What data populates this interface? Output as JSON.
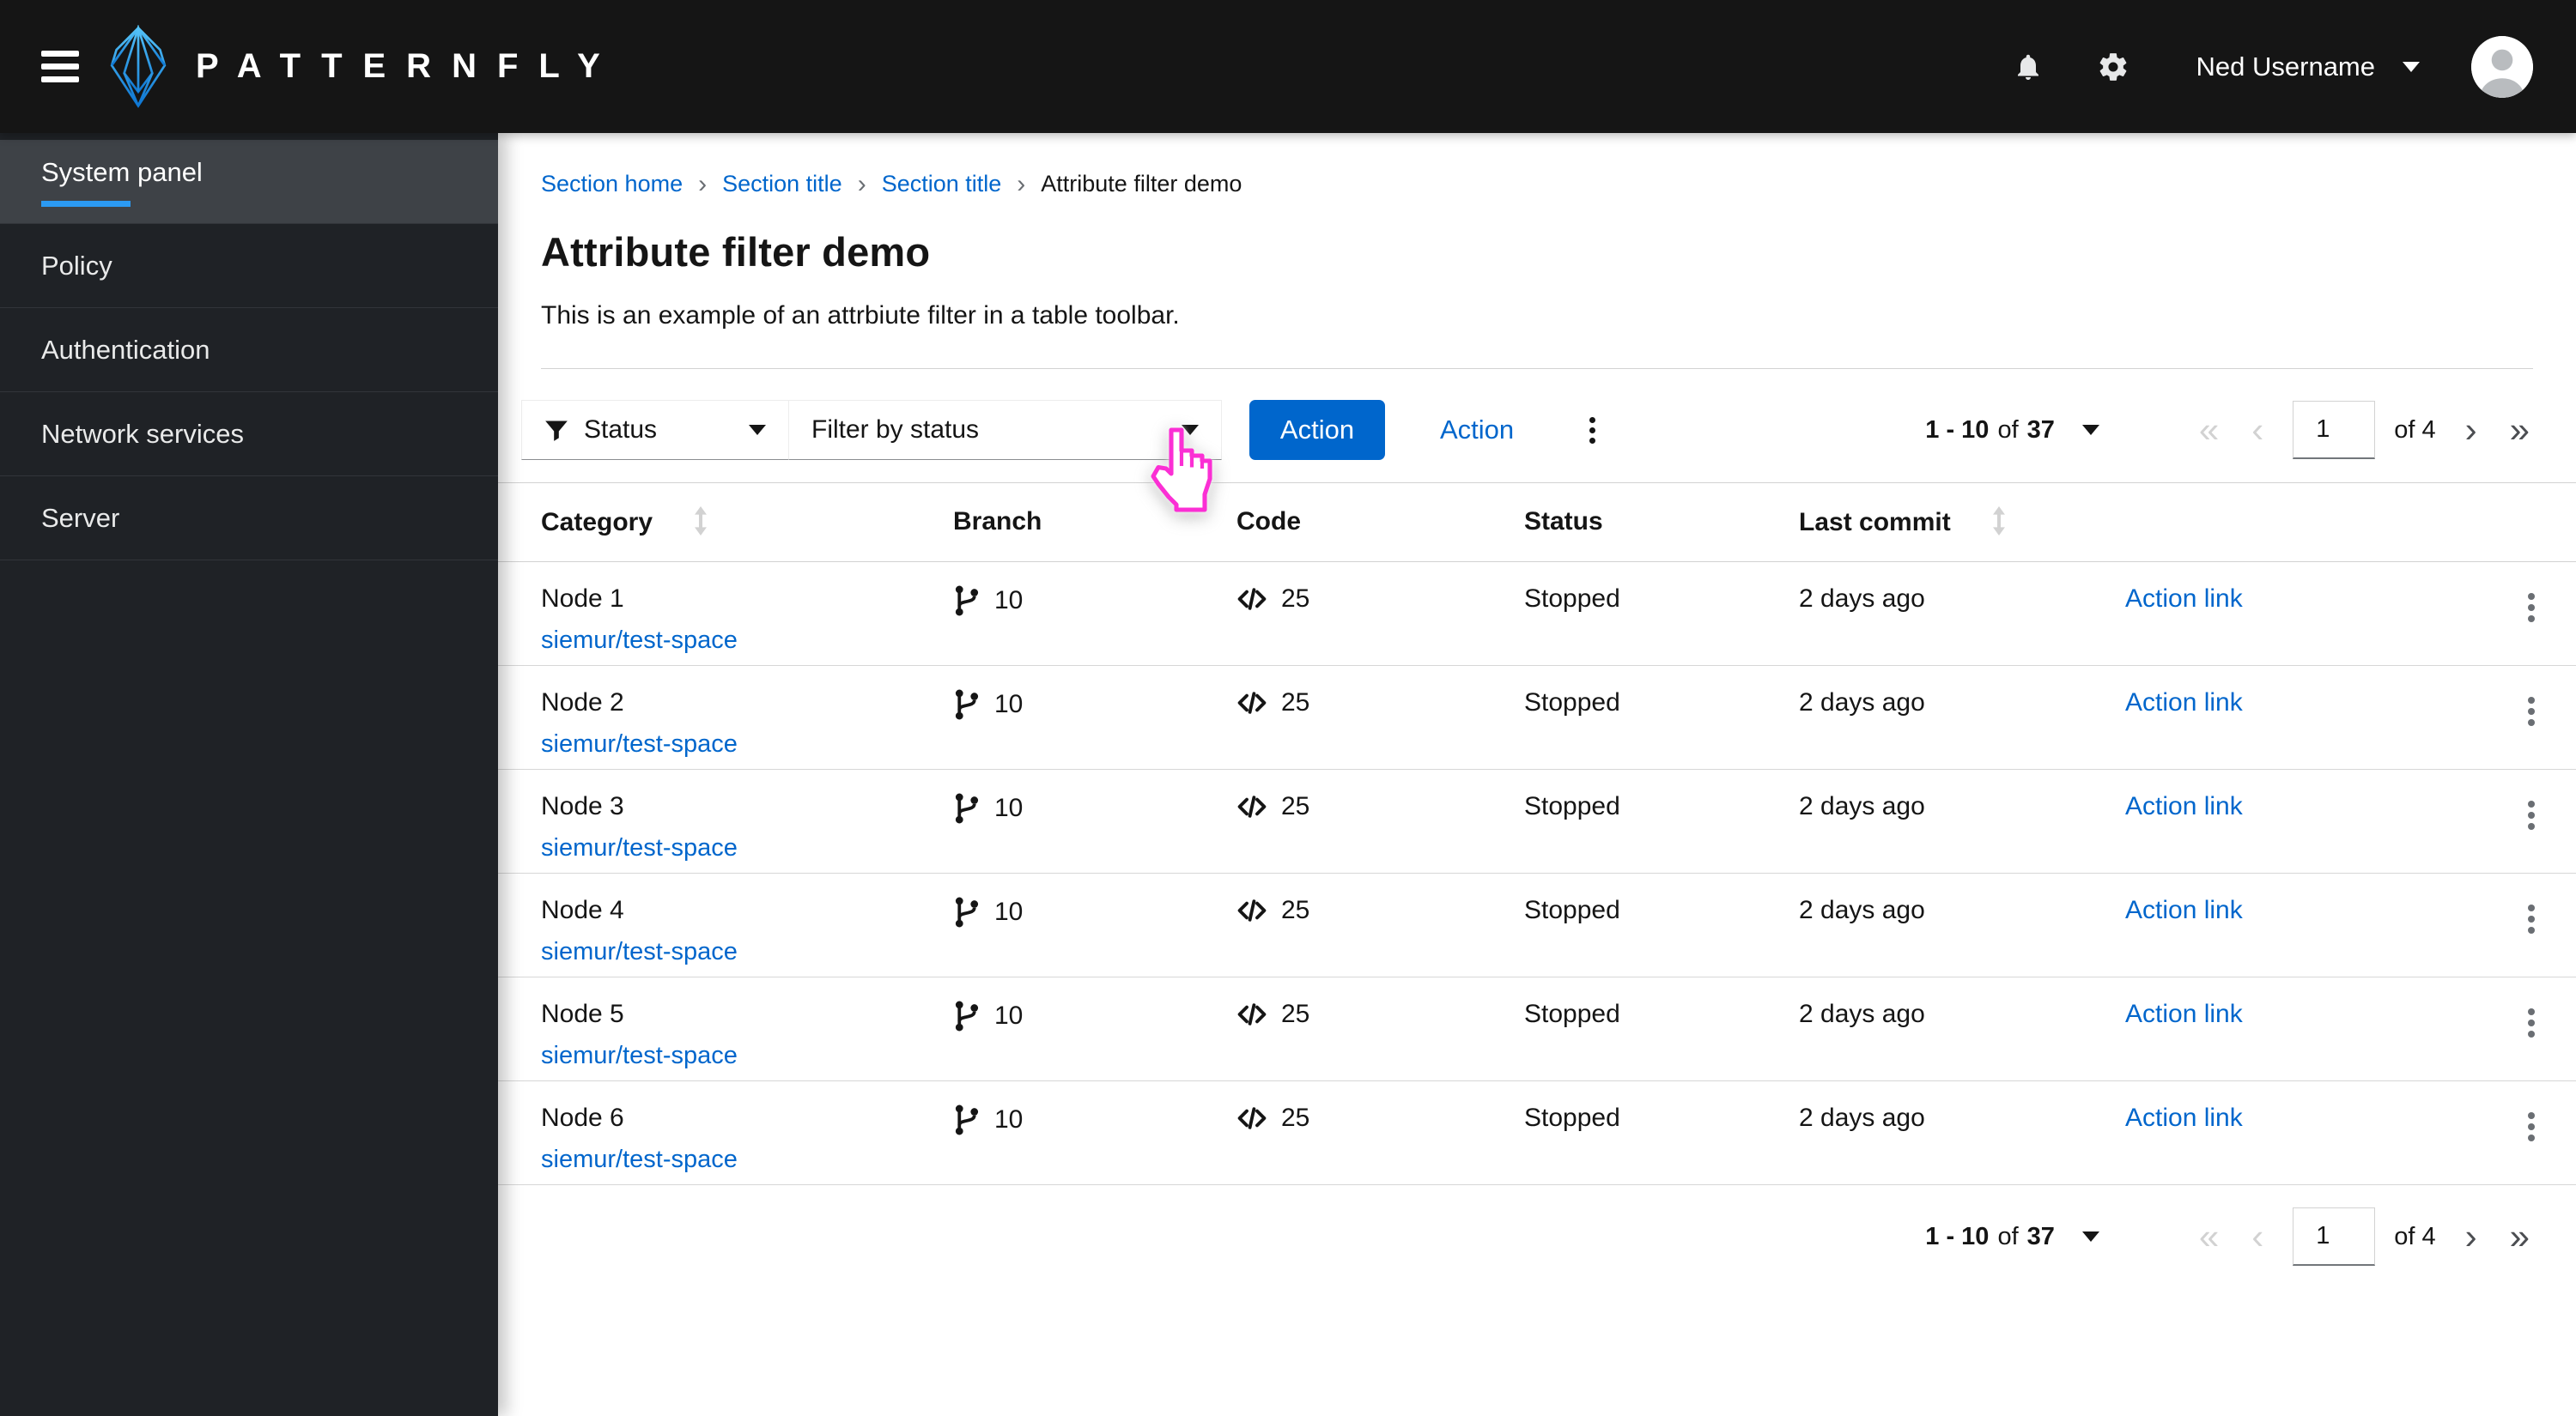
{
  "masthead": {
    "brand": "PATTERNFLY",
    "user": "Ned Username"
  },
  "sidebar": {
    "items": [
      {
        "label": "System panel"
      },
      {
        "label": "Policy"
      },
      {
        "label": "Authentication"
      },
      {
        "label": "Network services"
      },
      {
        "label": "Server"
      }
    ]
  },
  "breadcrumb": {
    "items": [
      "Section home",
      "Section title",
      "Section title",
      "Attribute filter demo"
    ],
    "separator": "›"
  },
  "page": {
    "title": "Attribute filter demo",
    "description": "This is an example of an attrbiute filter in a table toolbar."
  },
  "toolbar": {
    "attribute_label": "Status",
    "filter_placeholder": "Filter by status",
    "primary_action": "Action",
    "link_action": "Action"
  },
  "pagination": {
    "range": "1 - 10",
    "of_word": "of",
    "total": "37",
    "page": "1",
    "of_pages": "of 4",
    "first_icon": "«",
    "prev_icon": "‹",
    "next_icon": "›",
    "last_icon": "»"
  },
  "table": {
    "headers": [
      "Category",
      "Branch",
      "Code",
      "Status",
      "Last commit"
    ],
    "rows": [
      {
        "name": "Node 1",
        "link": "siemur/test-space",
        "branch": "10",
        "code": "25",
        "status": "Stopped",
        "commit": "2 days ago",
        "action": "Action link"
      },
      {
        "name": "Node 2",
        "link": "siemur/test-space",
        "branch": "10",
        "code": "25",
        "status": "Stopped",
        "commit": "2 days ago",
        "action": "Action link"
      },
      {
        "name": "Node 3",
        "link": "siemur/test-space",
        "branch": "10",
        "code": "25",
        "status": "Stopped",
        "commit": "2 days ago",
        "action": "Action link"
      },
      {
        "name": "Node 4",
        "link": "siemur/test-space",
        "branch": "10",
        "code": "25",
        "status": "Stopped",
        "commit": "2 days ago",
        "action": "Action link"
      },
      {
        "name": "Node 5",
        "link": "siemur/test-space",
        "branch": "10",
        "code": "25",
        "status": "Stopped",
        "commit": "2 days ago",
        "action": "Action link"
      },
      {
        "name": "Node 6",
        "link": "siemur/test-space",
        "branch": "10",
        "code": "25",
        "status": "Stopped",
        "commit": "2 days ago",
        "action": "Action link"
      }
    ]
  },
  "colors": {
    "accent_blue": "#0066cc",
    "nav_highlight": "#2b9af3",
    "masthead_bg": "#151515",
    "sidebar_bg": "#1f2226",
    "cursor_pink": "#fb2fd4"
  }
}
